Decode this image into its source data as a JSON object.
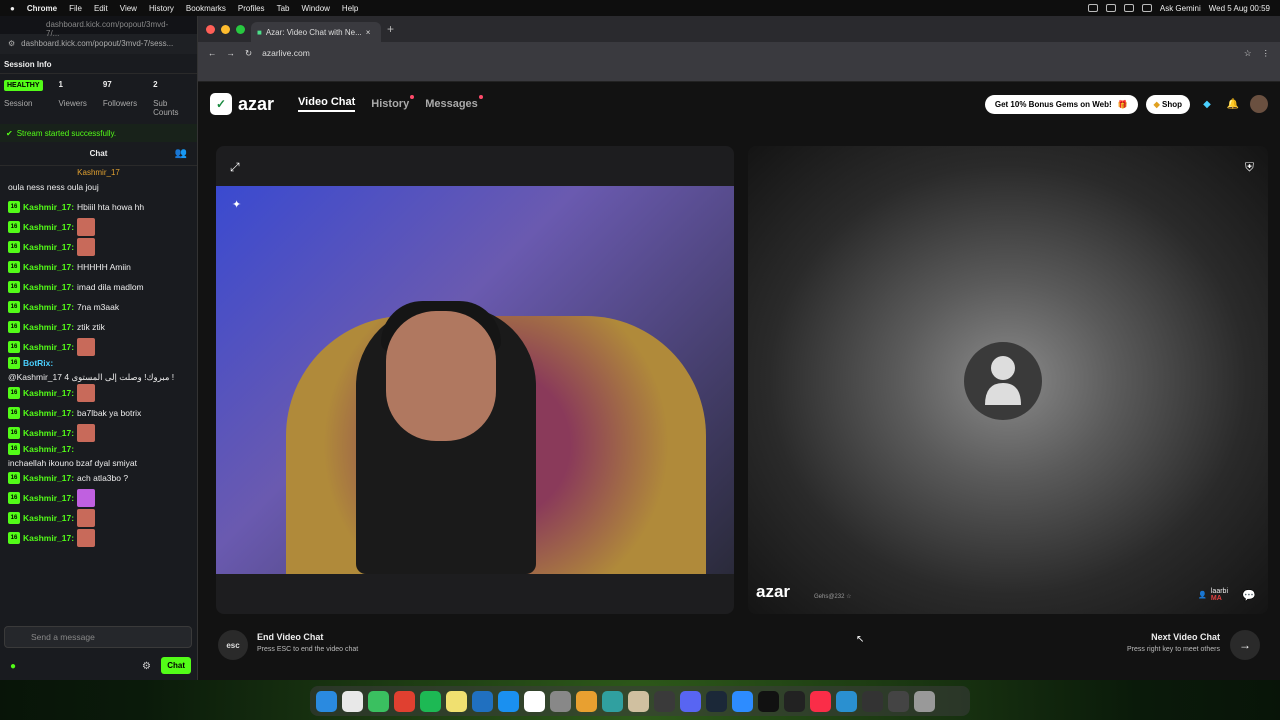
{
  "menubar": {
    "apple": "",
    "app": "Chrome",
    "items": [
      "File",
      "Edit",
      "View",
      "History",
      "Bookmarks",
      "Profiles",
      "Tab",
      "Window",
      "Help"
    ],
    "ai": "Ask Gemini",
    "clock": "Wed 5 Aug  00:59"
  },
  "popout": {
    "url_faded": "dashboard.kick.com/popout/3mvd-7/...",
    "url": "dashboard.kick.com/popout/3mvd-7/sess...",
    "title": "Session Info",
    "health": "HEALTHY",
    "session_label": "Session",
    "viewers": "1",
    "viewers_label": "Viewers",
    "followers": "97",
    "followers_label": "Followers",
    "subs": "2",
    "subs_label": "Sub Counts",
    "started": "Stream started successfully.",
    "chat_label": "Chat",
    "pinned_user": "Kashmir_17",
    "send_placeholder": "Send a message",
    "chat_button": "Chat",
    "messages": [
      {
        "user": "",
        "text": "oula ness ness oula jouj",
        "emote": ""
      },
      {
        "user": "Kashmir_17:",
        "text": "Hbiiil hta howa hh",
        "emote": ""
      },
      {
        "user": "Kashmir_17:",
        "text": "",
        "emote": "e"
      },
      {
        "user": "Kashmir_17:",
        "text": "",
        "emote": "e"
      },
      {
        "user": "Kashmir_17:",
        "text": "HHHHH Amiin",
        "emote": ""
      },
      {
        "user": "Kashmir_17:",
        "text": "imad dila madlom",
        "emote": ""
      },
      {
        "user": "Kashmir_17:",
        "text": "7na m3aak",
        "emote": ""
      },
      {
        "user": "Kashmir_17:",
        "text": "ztik ztik",
        "emote": ""
      },
      {
        "user": "Kashmir_17:",
        "text": "",
        "emote": "e"
      },
      {
        "user": "BotRix:",
        "text": "@Kashmir_17 مبروك! وصلت إلى المستوى 4 !",
        "emote": "",
        "bot": true
      },
      {
        "user": "Kashmir_17:",
        "text": "",
        "emote": "e"
      },
      {
        "user": "Kashmir_17:",
        "text": "ba7lbak ya botrix",
        "emote": ""
      },
      {
        "user": "Kashmir_17:",
        "text": "",
        "emote": "e"
      },
      {
        "user": "Kashmir_17:",
        "text": "inchaellah ikouno bzaf dyal smiyat",
        "emote": ""
      },
      {
        "user": "Kashmir_17:",
        "text": "ach atla3bo ?",
        "emote": ""
      },
      {
        "user": "Kashmir_17:",
        "text": "",
        "emote": "p"
      },
      {
        "user": "Kashmir_17:",
        "text": "",
        "emote": "e"
      },
      {
        "user": "Kashmir_17:",
        "text": "",
        "emote": "e"
      }
    ]
  },
  "browser": {
    "tab_title": "Azar: Video Chat with Ne...",
    "url": "azarlive.com"
  },
  "azar": {
    "logo": "azar",
    "nav": [
      "Video Chat",
      "History",
      "Messages"
    ],
    "promo": "Get 10% Bonus Gems on Web!",
    "shop": "Shop",
    "watermark": "azar",
    "wm_id": "Gehs@232 ☆",
    "partner_name": "laarbi",
    "partner_country": "MA",
    "esc": "esc",
    "end_title": "End Video Chat",
    "end_sub": "Press ESC to end the video chat",
    "next_title": "Next Video Chat",
    "next_sub": "Press right key to meet others"
  },
  "colors": {
    "kick_green": "#53fc18",
    "azar_green": "#1a8a40"
  }
}
